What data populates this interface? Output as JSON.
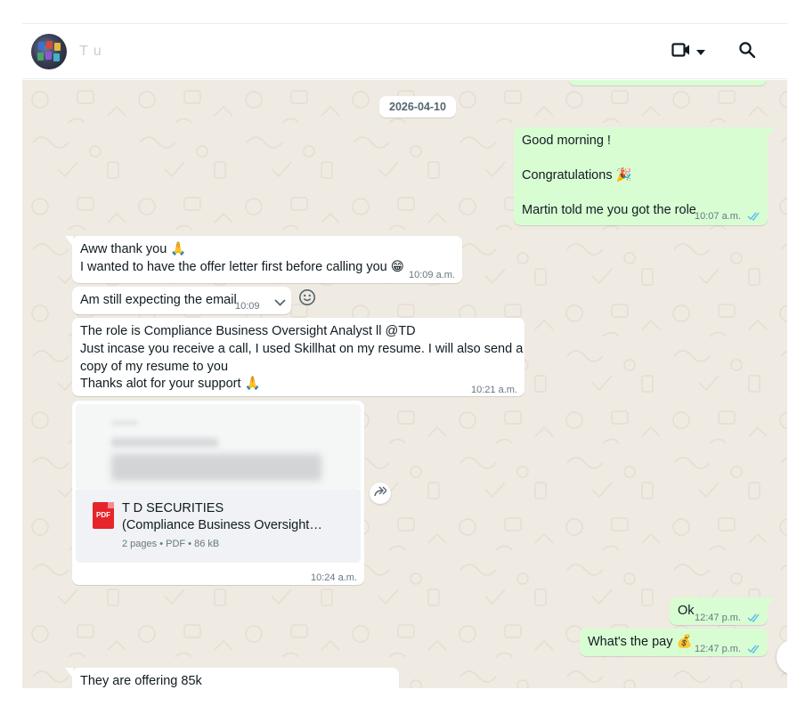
{
  "header": {
    "contact_name": "T         u",
    "video_icon": "video-call-icon",
    "dropdown_icon": "caret-down-icon",
    "search_icon": "search-icon"
  },
  "chat": {
    "date_divider": "2026-04-10",
    "messages": [
      {
        "dir": "out",
        "lines": [
          "Good morning !",
          "Congratulations 🎉",
          "Martin told me you got the role"
        ],
        "time": "10:07 a.m.",
        "status": "read"
      },
      {
        "dir": "in",
        "lines": [
          "Aww thank you 🙏",
          "I wanted to have the offer letter first before calling you 😁"
        ],
        "time": "10:09 a.m."
      },
      {
        "dir": "in",
        "lines": [
          "Am still expecting the email"
        ],
        "time": "10:09 a.m."
      },
      {
        "dir": "in",
        "lines": [
          "The role is Compliance Business Oversight Analyst ll @TD",
          "Just incase you receive a call, I used Skillhat on my resume. I will also send a",
          "copy of my resume to you",
          "Thanks alot for your support 🙏"
        ],
        "time": "10:21 a.m."
      },
      {
        "dir": "in",
        "type": "document",
        "doc_title_1": "T              D SECURITIES",
        "doc_title_2": "(Compliance Business Oversight…",
        "doc_meta": "2 pages • PDF • 86 kB",
        "doc_badge": "PDF",
        "time": "10:24 a.m."
      },
      {
        "dir": "out",
        "lines": [
          "Ok"
        ],
        "time": "12:47 p.m.",
        "status": "read"
      },
      {
        "dir": "out",
        "lines": [
          "What's the pay 💰"
        ],
        "time": "12:47 p.m.",
        "status": "read"
      },
      {
        "dir": "in",
        "lines": [
          "They are offering 85k"
        ],
        "time": ""
      }
    ]
  },
  "colors": {
    "incoming": "#ffffff",
    "outgoing": "#d9fdd3",
    "chat_bg": "#efeae2",
    "read_ticks": "#53bdeb"
  }
}
